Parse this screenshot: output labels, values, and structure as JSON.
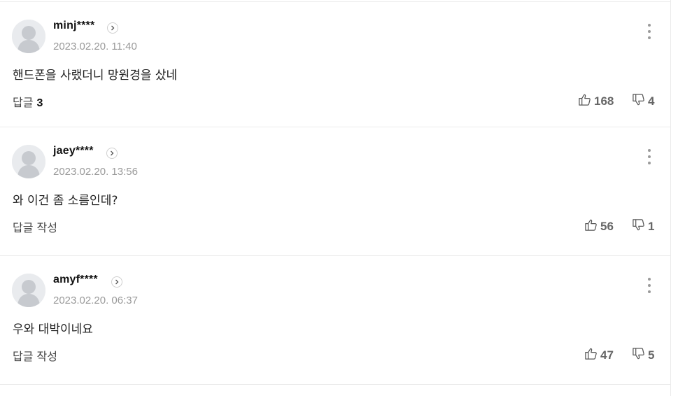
{
  "comments": [
    {
      "author": "minj****",
      "date": "2023.02.20. 11:40",
      "text": "핸드폰을 사랬더니 망원경을 샀네",
      "reply_label": "답글",
      "reply_count": "3",
      "likes": "168",
      "dislikes": "4"
    },
    {
      "author": "jaey****",
      "date": "2023.02.20. 13:56",
      "text": "와 이건 좀 소름인데?",
      "reply_label": "답글 작성",
      "reply_count": "",
      "likes": "56",
      "dislikes": "1"
    },
    {
      "author": "amyf****",
      "date": "2023.02.20. 06:37",
      "text": "우와 대박이네요",
      "reply_label": "답글 작성",
      "reply_count": "",
      "likes": "47",
      "dislikes": "5"
    }
  ],
  "icons": {
    "profile": "avatar-placeholder-icon",
    "author_link": "chevron-right-icon",
    "more": "more-vertical-icon",
    "like": "thumbs-up-icon",
    "dislike": "thumbs-down-icon"
  }
}
